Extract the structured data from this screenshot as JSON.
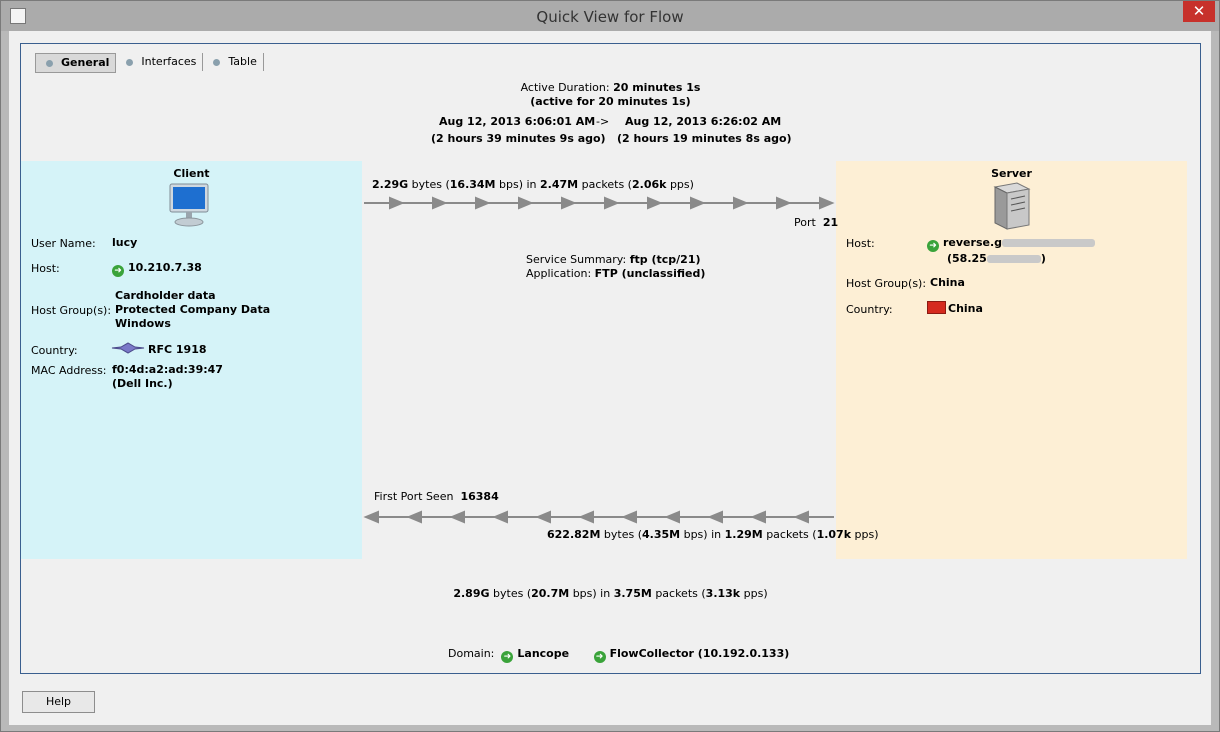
{
  "window": {
    "title": "Quick View for Flow",
    "close_glyph": "✕"
  },
  "tabs": [
    {
      "label": "General"
    },
    {
      "label": "Interfaces"
    },
    {
      "label": "Table"
    }
  ],
  "duration": {
    "label": "Active Duration:",
    "value": "20 minutes 1s",
    "active_note": "(active for 20 minutes 1s)",
    "start": "Aug 12, 2013 6:06:01 AM",
    "arrow": "->",
    "end": "Aug 12, 2013 6:26:02 AM",
    "start_ago": "(2 hours 39 minutes 9s ago)",
    "end_ago": "(2 hours 19 minutes 8s ago)"
  },
  "client": {
    "title": "Client",
    "user_label": "User Name:",
    "user": "lucy",
    "host_label": "Host:",
    "host": "10.210.7.38",
    "group_label": "Host Group(s):",
    "groups": [
      "Cardholder data",
      "Protected Company Data",
      "Windows"
    ],
    "country_label": "Country:",
    "country": "RFC 1918",
    "mac_label": "MAC Address:",
    "mac": "f0:4d:a2:ad:39:47",
    "mac_vendor": "(Dell Inc.)"
  },
  "server": {
    "title": "Server",
    "host_label": "Host:",
    "host_prefix": "reverse.g",
    "host_ip_prefix": "(58.25",
    "host_ip_suffix": ")",
    "group_label": "Host Group(s):",
    "group": "China",
    "country_label": "Country:",
    "country": "China"
  },
  "traffic": {
    "out_bytes": "2.29G",
    "out_bps": "16.34M",
    "out_packets": "2.47M",
    "out_pps": "2.06k",
    "port_label": "Port",
    "port": "21",
    "service_label": "Service Summary:",
    "service": "ftp (tcp/21)",
    "app_label": "Application:",
    "app": "FTP (unclassified)",
    "first_port_label": "First Port Seen",
    "first_port": "16384",
    "in_bytes": "622.82M",
    "in_bps": "4.35M",
    "in_packets": "1.29M",
    "in_pps": "1.07k",
    "total_bytes": "2.89G",
    "total_bps": "20.7M",
    "total_packets": "3.75M",
    "total_pps": "3.13k",
    "w_bytes": "bytes (",
    "w_bps": "bps) in",
    "w_packets": "packets (",
    "w_pps": "pps)"
  },
  "domain": {
    "label": "Domain:",
    "name": "Lancope",
    "collector": "FlowCollector (10.192.0.133)"
  },
  "help_label": "Help",
  "colors": {
    "client_bg": "#d5f3f8",
    "server_bg": "#fdefd5",
    "arrow": "#888888",
    "ok_icon": "#3aa33a"
  }
}
